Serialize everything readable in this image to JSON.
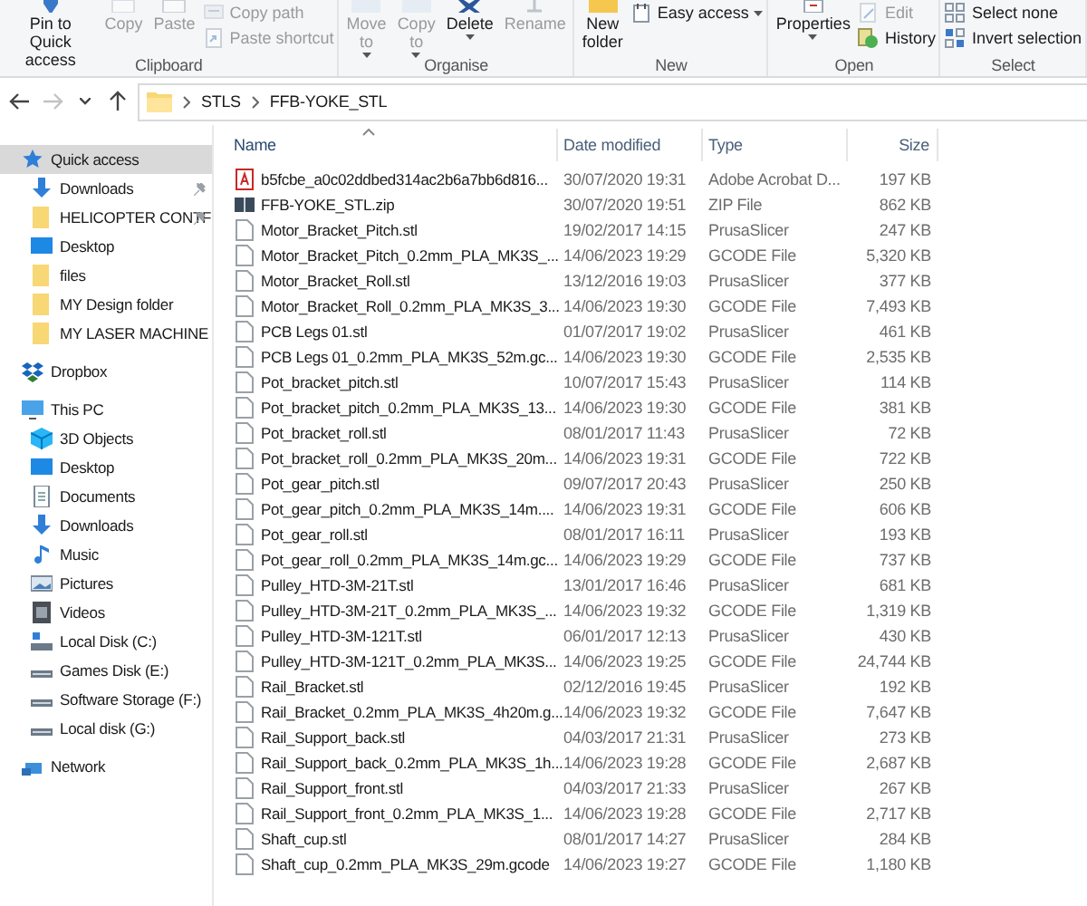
{
  "ribbon": {
    "groups": [
      {
        "label": "Clipboard",
        "buttons": [
          {
            "kind": "large",
            "label": "Pin to Quick access",
            "disabled": false
          },
          {
            "kind": "large",
            "label": "Copy",
            "disabled": true
          },
          {
            "kind": "large",
            "label": "Paste",
            "disabled": true
          },
          {
            "kind": "small",
            "label": "Copy path",
            "disabled": true
          },
          {
            "kind": "small",
            "label": "Paste shortcut",
            "disabled": true
          }
        ]
      },
      {
        "label": "Organise",
        "buttons": [
          {
            "kind": "large",
            "label": "Move to",
            "disabled": true,
            "dropdown": true
          },
          {
            "kind": "large",
            "label": "Copy to",
            "disabled": true,
            "dropdown": true
          },
          {
            "kind": "large",
            "label": "Delete",
            "disabled": false,
            "dropdown": true
          },
          {
            "kind": "large",
            "label": "Rename",
            "disabled": true
          }
        ]
      },
      {
        "label": "New",
        "buttons": [
          {
            "kind": "large",
            "label": "New folder",
            "disabled": false
          },
          {
            "kind": "small",
            "label": "Easy access",
            "disabled": false,
            "dropdown": true
          }
        ]
      },
      {
        "label": "Open",
        "buttons": [
          {
            "kind": "large",
            "label": "Properties",
            "disabled": false,
            "dropdown": true
          },
          {
            "kind": "small",
            "label": "Edit",
            "disabled": true
          },
          {
            "kind": "small",
            "label": "History",
            "disabled": false
          }
        ]
      },
      {
        "label": "Select",
        "buttons": [
          {
            "kind": "small",
            "label": "Select none",
            "disabled": false
          },
          {
            "kind": "small",
            "label": "Invert selection",
            "disabled": false
          }
        ]
      }
    ]
  },
  "navigation": [
    {
      "kind": "back",
      "disabled": false
    },
    {
      "kind": "forward",
      "disabled": true
    },
    {
      "kind": "recent",
      "disabled": false
    },
    {
      "kind": "up",
      "disabled": false
    }
  ],
  "breadcrumb": [
    "STLS",
    "FFB-YOKE_STL"
  ],
  "sidebar": {
    "items": [
      {
        "label": "Quick access",
        "kind": "star",
        "selected": true,
        "children": [
          {
            "label": "Downloads",
            "kind": "download",
            "selected": false,
            "pinned": true
          },
          {
            "label": "HELICOPTER CONTF",
            "kind": "folder",
            "selected": false,
            "pinned": true
          },
          {
            "label": "Desktop",
            "kind": "desktop",
            "selected": false,
            "pinned": false
          },
          {
            "label": "files",
            "kind": "folder",
            "selected": false,
            "pinned": false
          },
          {
            "label": "MY Design folder",
            "kind": "folder",
            "selected": false,
            "pinned": false
          },
          {
            "label": "MY LASER MACHINE",
            "kind": "folder",
            "selected": false,
            "pinned": false
          }
        ]
      },
      {
        "label": "Dropbox",
        "kind": "dropbox",
        "selected": false
      },
      {
        "label": "This PC",
        "kind": "pc",
        "selected": false,
        "children": [
          {
            "label": "3D Objects",
            "kind": "cube",
            "selected": false
          },
          {
            "label": "Desktop",
            "kind": "desktop",
            "selected": false
          },
          {
            "label": "Documents",
            "kind": "documents",
            "selected": false
          },
          {
            "label": "Downloads",
            "kind": "download",
            "selected": false
          },
          {
            "label": "Music",
            "kind": "music",
            "selected": false
          },
          {
            "label": "Pictures",
            "kind": "pictures",
            "selected": false
          },
          {
            "label": "Videos",
            "kind": "videos",
            "selected": false
          },
          {
            "label": "Local Disk (C:)",
            "kind": "system-drive",
            "selected": false
          },
          {
            "label": "Games Disk (E:)",
            "kind": "drive",
            "selected": false
          },
          {
            "label": "Software Storage (F:)",
            "kind": "drive",
            "selected": false
          },
          {
            "label": "Local disk (G:)",
            "kind": "drive",
            "selected": false
          }
        ]
      },
      {
        "label": "Network",
        "kind": "network",
        "selected": false
      }
    ]
  },
  "table": {
    "columns": [
      {
        "label": "Name",
        "sorted": true
      },
      {
        "label": "Date modified",
        "sorted": false
      },
      {
        "label": "Type",
        "sorted": false
      },
      {
        "label": "Size",
        "sorted": false
      }
    ],
    "rows": [
      {
        "kind": "pdf",
        "name": "b5fcbe_a0c02ddbed314ac2b6a7bb6d816...",
        "date": "30/07/2020 19:31",
        "type": "Adobe Acrobat D...",
        "size": "197 KB"
      },
      {
        "kind": "zip",
        "name": "FFB-YOKE_STL.zip",
        "date": "30/07/2020 19:51",
        "type": "ZIP File",
        "size": "862 KB"
      },
      {
        "kind": "file",
        "name": "Motor_Bracket_Pitch.stl",
        "date": "19/02/2017 14:15",
        "type": "PrusaSlicer",
        "size": "247 KB"
      },
      {
        "kind": "file",
        "name": "Motor_Bracket_Pitch_0.2mm_PLA_MK3S_...",
        "date": "14/06/2023 19:29",
        "type": "GCODE File",
        "size": "5,320 KB"
      },
      {
        "kind": "file",
        "name": "Motor_Bracket_Roll.stl",
        "date": "13/12/2016 19:03",
        "type": "PrusaSlicer",
        "size": "377 KB"
      },
      {
        "kind": "file",
        "name": "Motor_Bracket_Roll_0.2mm_PLA_MK3S_3...",
        "date": "14/06/2023 19:30",
        "type": "GCODE File",
        "size": "7,493 KB"
      },
      {
        "kind": "file",
        "name": "PCB Legs 01.stl",
        "date": "01/07/2017 19:02",
        "type": "PrusaSlicer",
        "size": "461 KB"
      },
      {
        "kind": "file",
        "name": "PCB Legs 01_0.2mm_PLA_MK3S_52m.gc...",
        "date": "14/06/2023 19:30",
        "type": "GCODE File",
        "size": "2,535 KB"
      },
      {
        "kind": "file",
        "name": "Pot_bracket_pitch.stl",
        "date": "10/07/2017 15:43",
        "type": "PrusaSlicer",
        "size": "114 KB"
      },
      {
        "kind": "file",
        "name": "Pot_bracket_pitch_0.2mm_PLA_MK3S_13...",
        "date": "14/06/2023 19:30",
        "type": "GCODE File",
        "size": "381 KB"
      },
      {
        "kind": "file",
        "name": "Pot_bracket_roll.stl",
        "date": "08/01/2017 11:43",
        "type": "PrusaSlicer",
        "size": "72 KB"
      },
      {
        "kind": "file",
        "name": "Pot_bracket_roll_0.2mm_PLA_MK3S_20m...",
        "date": "14/06/2023 19:31",
        "type": "GCODE File",
        "size": "722 KB"
      },
      {
        "kind": "file",
        "name": "Pot_gear_pitch.stl",
        "date": "09/07/2017 20:43",
        "type": "PrusaSlicer",
        "size": "250 KB"
      },
      {
        "kind": "file",
        "name": "Pot_gear_pitch_0.2mm_PLA_MK3S_14m....",
        "date": "14/06/2023 19:31",
        "type": "GCODE File",
        "size": "606 KB"
      },
      {
        "kind": "file",
        "name": "Pot_gear_roll.stl",
        "date": "08/01/2017 16:11",
        "type": "PrusaSlicer",
        "size": "193 KB"
      },
      {
        "kind": "file",
        "name": "Pot_gear_roll_0.2mm_PLA_MK3S_14m.gc...",
        "date": "14/06/2023 19:29",
        "type": "GCODE File",
        "size": "737 KB"
      },
      {
        "kind": "file",
        "name": "Pulley_HTD-3M-21T.stl",
        "date": "13/01/2017 16:46",
        "type": "PrusaSlicer",
        "size": "681 KB"
      },
      {
        "kind": "file",
        "name": "Pulley_HTD-3M-21T_0.2mm_PLA_MK3S_...",
        "date": "14/06/2023 19:32",
        "type": "GCODE File",
        "size": "1,319 KB"
      },
      {
        "kind": "file",
        "name": "Pulley_HTD-3M-121T.stl",
        "date": "06/01/2017 12:13",
        "type": "PrusaSlicer",
        "size": "430 KB"
      },
      {
        "kind": "file",
        "name": "Pulley_HTD-3M-121T_0.2mm_PLA_MK3S...",
        "date": "14/06/2023 19:25",
        "type": "GCODE File",
        "size": "24,744 KB"
      },
      {
        "kind": "file",
        "name": "Rail_Bracket.stl",
        "date": "02/12/2016 19:45",
        "type": "PrusaSlicer",
        "size": "192 KB"
      },
      {
        "kind": "file",
        "name": "Rail_Bracket_0.2mm_PLA_MK3S_4h20m.g...",
        "date": "14/06/2023 19:32",
        "type": "GCODE File",
        "size": "7,647 KB"
      },
      {
        "kind": "file",
        "name": "Rail_Support_back.stl",
        "date": "04/03/2017 21:31",
        "type": "PrusaSlicer",
        "size": "273 KB"
      },
      {
        "kind": "file",
        "name": "Rail_Support_back_0.2mm_PLA_MK3S_1h...",
        "date": "14/06/2023 19:28",
        "type": "GCODE File",
        "size": "2,687 KB"
      },
      {
        "kind": "file",
        "name": "Rail_Support_front.stl",
        "date": "04/03/2017 21:33",
        "type": "PrusaSlicer",
        "size": "267 KB"
      },
      {
        "kind": "file",
        "name": "Rail_Support_front_0.2mm_PLA_MK3S_1...",
        "date": "14/06/2023 19:28",
        "type": "GCODE File",
        "size": "2,717 KB"
      },
      {
        "kind": "file",
        "name": "Shaft_cup.stl",
        "date": "08/01/2017 14:27",
        "type": "PrusaSlicer",
        "size": "284 KB"
      },
      {
        "kind": "file",
        "name": "Shaft_cup_0.2mm_PLA_MK3S_29m.gcode",
        "date": "14/06/2023 19:27",
        "type": "GCODE File",
        "size": "1,180 KB"
      }
    ]
  }
}
